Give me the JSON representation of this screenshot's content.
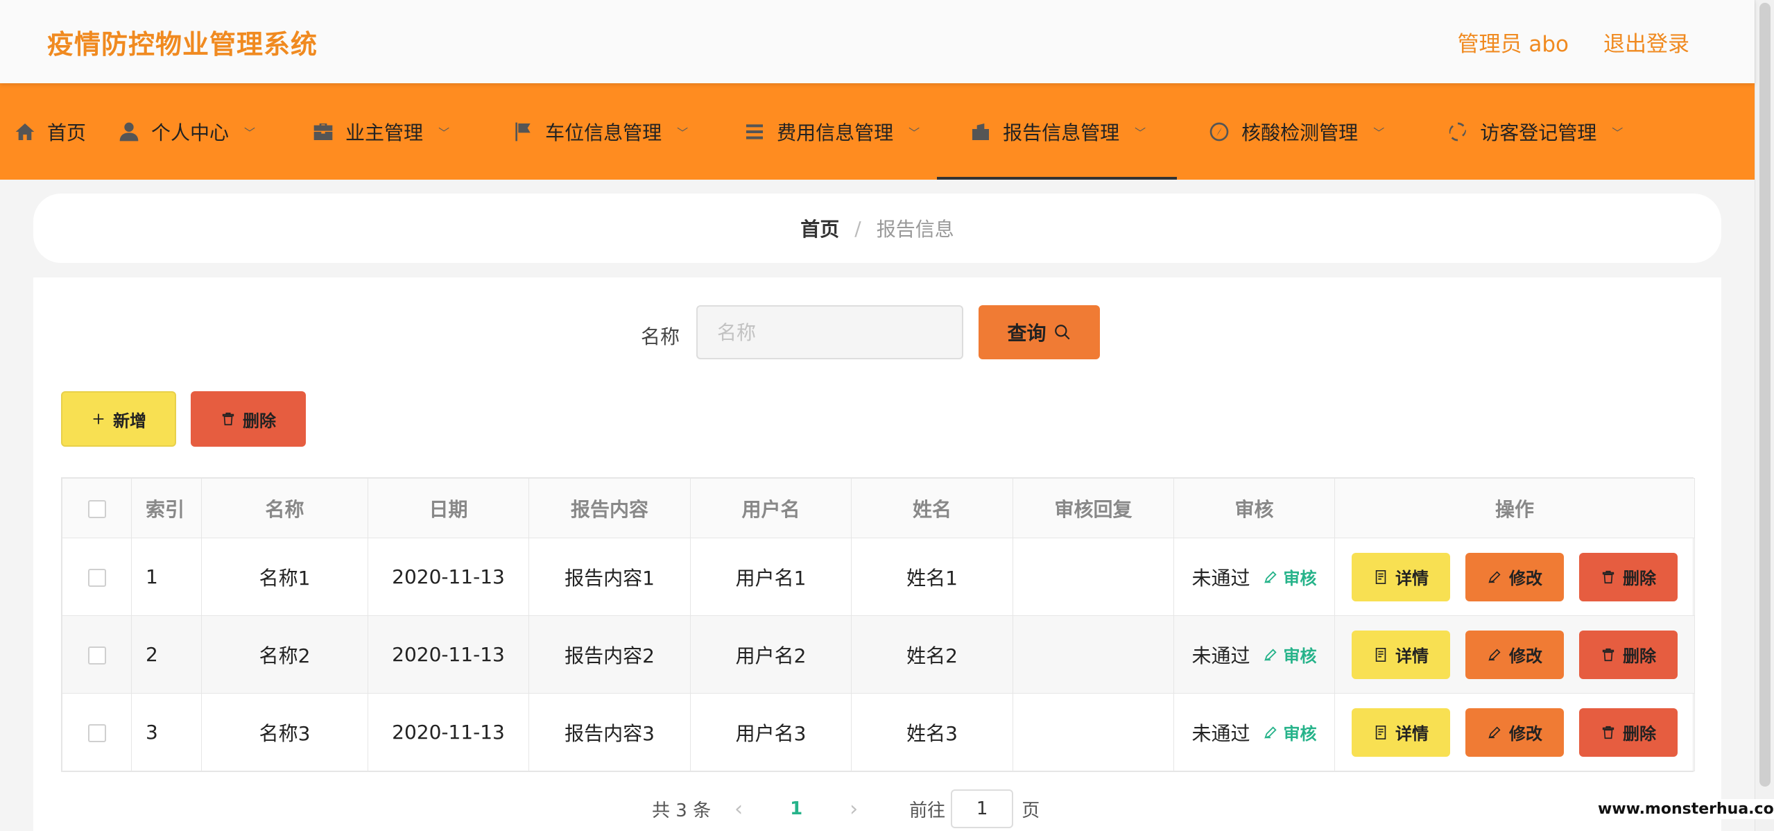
{
  "header": {
    "app_title": "疫情防控物业管理系统",
    "user_label": "管理员 abo",
    "logout_label": "退出登录",
    "accent_color": "#f08a20"
  },
  "nav": {
    "items": [
      {
        "label": "首页",
        "icon": "home-icon",
        "has_dropdown": false
      },
      {
        "label": "个人中心",
        "icon": "user-icon",
        "has_dropdown": true
      },
      {
        "label": "业主管理",
        "icon": "briefcase-icon",
        "has_dropdown": true
      },
      {
        "label": "车位信息管理",
        "icon": "flag-icon",
        "has_dropdown": true
      },
      {
        "label": "费用信息管理",
        "icon": "list-icon",
        "has_dropdown": true
      },
      {
        "label": "报告信息管理",
        "icon": "report-icon",
        "has_dropdown": true,
        "active": true
      },
      {
        "label": "核酸检测管理",
        "icon": "compass-icon",
        "has_dropdown": true
      },
      {
        "label": "访客登记管理",
        "icon": "dashed-circle-icon",
        "has_dropdown": true
      }
    ],
    "background_color": "#ff8c20"
  },
  "breadcrumb": {
    "home": "首页",
    "separator": "/",
    "current": "报告信息"
  },
  "search": {
    "label": "名称",
    "placeholder": "名称",
    "value": "",
    "button_label": "查询"
  },
  "toolbar": {
    "add_label": "新增",
    "delete_label": "删除"
  },
  "table": {
    "columns": [
      "索引",
      "名称",
      "日期",
      "报告内容",
      "用户名",
      "姓名",
      "审核回复",
      "审核",
      "操作"
    ],
    "rows": [
      {
        "index": "1",
        "name": "名称1",
        "date": "2020-11-13",
        "content": "报告内容1",
        "username": "用户名1",
        "realname": "姓名1",
        "reply": "",
        "status": "未通过"
      },
      {
        "index": "2",
        "name": "名称2",
        "date": "2020-11-13",
        "content": "报告内容2",
        "username": "用户名2",
        "realname": "姓名2",
        "reply": "",
        "status": "未通过"
      },
      {
        "index": "3",
        "name": "名称3",
        "date": "2020-11-13",
        "content": "报告内容3",
        "username": "用户名3",
        "realname": "姓名3",
        "reply": "",
        "status": "未通过"
      }
    ],
    "audit_link_label": "审核",
    "detail_label": "详情",
    "edit_label": "修改",
    "delete_label": "删除"
  },
  "pagination": {
    "total_text": "共 3 条",
    "current_page": "1",
    "goto_label": "前往",
    "goto_value": "1",
    "page_suffix": "页"
  },
  "watermark": "www.monsterhua.com"
}
